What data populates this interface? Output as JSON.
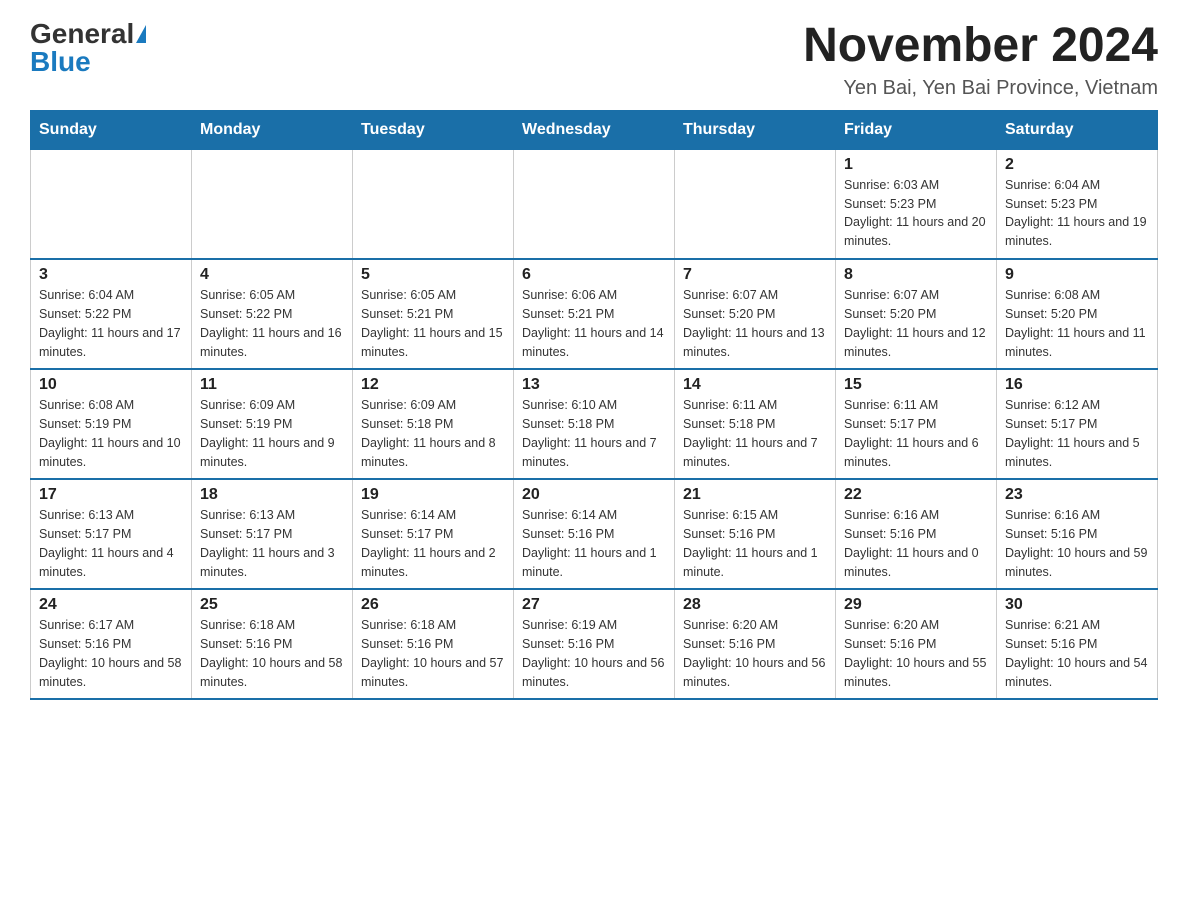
{
  "logo": {
    "general": "General",
    "blue": "Blue"
  },
  "title": "November 2024",
  "subtitle": "Yen Bai, Yen Bai Province, Vietnam",
  "weekdays": [
    "Sunday",
    "Monday",
    "Tuesday",
    "Wednesday",
    "Thursday",
    "Friday",
    "Saturday"
  ],
  "weeks": [
    [
      {
        "day": "",
        "info": ""
      },
      {
        "day": "",
        "info": ""
      },
      {
        "day": "",
        "info": ""
      },
      {
        "day": "",
        "info": ""
      },
      {
        "day": "",
        "info": ""
      },
      {
        "day": "1",
        "info": "Sunrise: 6:03 AM\nSunset: 5:23 PM\nDaylight: 11 hours and 20 minutes."
      },
      {
        "day": "2",
        "info": "Sunrise: 6:04 AM\nSunset: 5:23 PM\nDaylight: 11 hours and 19 minutes."
      }
    ],
    [
      {
        "day": "3",
        "info": "Sunrise: 6:04 AM\nSunset: 5:22 PM\nDaylight: 11 hours and 17 minutes."
      },
      {
        "day": "4",
        "info": "Sunrise: 6:05 AM\nSunset: 5:22 PM\nDaylight: 11 hours and 16 minutes."
      },
      {
        "day": "5",
        "info": "Sunrise: 6:05 AM\nSunset: 5:21 PM\nDaylight: 11 hours and 15 minutes."
      },
      {
        "day": "6",
        "info": "Sunrise: 6:06 AM\nSunset: 5:21 PM\nDaylight: 11 hours and 14 minutes."
      },
      {
        "day": "7",
        "info": "Sunrise: 6:07 AM\nSunset: 5:20 PM\nDaylight: 11 hours and 13 minutes."
      },
      {
        "day": "8",
        "info": "Sunrise: 6:07 AM\nSunset: 5:20 PM\nDaylight: 11 hours and 12 minutes."
      },
      {
        "day": "9",
        "info": "Sunrise: 6:08 AM\nSunset: 5:20 PM\nDaylight: 11 hours and 11 minutes."
      }
    ],
    [
      {
        "day": "10",
        "info": "Sunrise: 6:08 AM\nSunset: 5:19 PM\nDaylight: 11 hours and 10 minutes."
      },
      {
        "day": "11",
        "info": "Sunrise: 6:09 AM\nSunset: 5:19 PM\nDaylight: 11 hours and 9 minutes."
      },
      {
        "day": "12",
        "info": "Sunrise: 6:09 AM\nSunset: 5:18 PM\nDaylight: 11 hours and 8 minutes."
      },
      {
        "day": "13",
        "info": "Sunrise: 6:10 AM\nSunset: 5:18 PM\nDaylight: 11 hours and 7 minutes."
      },
      {
        "day": "14",
        "info": "Sunrise: 6:11 AM\nSunset: 5:18 PM\nDaylight: 11 hours and 7 minutes."
      },
      {
        "day": "15",
        "info": "Sunrise: 6:11 AM\nSunset: 5:17 PM\nDaylight: 11 hours and 6 minutes."
      },
      {
        "day": "16",
        "info": "Sunrise: 6:12 AM\nSunset: 5:17 PM\nDaylight: 11 hours and 5 minutes."
      }
    ],
    [
      {
        "day": "17",
        "info": "Sunrise: 6:13 AM\nSunset: 5:17 PM\nDaylight: 11 hours and 4 minutes."
      },
      {
        "day": "18",
        "info": "Sunrise: 6:13 AM\nSunset: 5:17 PM\nDaylight: 11 hours and 3 minutes."
      },
      {
        "day": "19",
        "info": "Sunrise: 6:14 AM\nSunset: 5:17 PM\nDaylight: 11 hours and 2 minutes."
      },
      {
        "day": "20",
        "info": "Sunrise: 6:14 AM\nSunset: 5:16 PM\nDaylight: 11 hours and 1 minute."
      },
      {
        "day": "21",
        "info": "Sunrise: 6:15 AM\nSunset: 5:16 PM\nDaylight: 11 hours and 1 minute."
      },
      {
        "day": "22",
        "info": "Sunrise: 6:16 AM\nSunset: 5:16 PM\nDaylight: 11 hours and 0 minutes."
      },
      {
        "day": "23",
        "info": "Sunrise: 6:16 AM\nSunset: 5:16 PM\nDaylight: 10 hours and 59 minutes."
      }
    ],
    [
      {
        "day": "24",
        "info": "Sunrise: 6:17 AM\nSunset: 5:16 PM\nDaylight: 10 hours and 58 minutes."
      },
      {
        "day": "25",
        "info": "Sunrise: 6:18 AM\nSunset: 5:16 PM\nDaylight: 10 hours and 58 minutes."
      },
      {
        "day": "26",
        "info": "Sunrise: 6:18 AM\nSunset: 5:16 PM\nDaylight: 10 hours and 57 minutes."
      },
      {
        "day": "27",
        "info": "Sunrise: 6:19 AM\nSunset: 5:16 PM\nDaylight: 10 hours and 56 minutes."
      },
      {
        "day": "28",
        "info": "Sunrise: 6:20 AM\nSunset: 5:16 PM\nDaylight: 10 hours and 56 minutes."
      },
      {
        "day": "29",
        "info": "Sunrise: 6:20 AM\nSunset: 5:16 PM\nDaylight: 10 hours and 55 minutes."
      },
      {
        "day": "30",
        "info": "Sunrise: 6:21 AM\nSunset: 5:16 PM\nDaylight: 10 hours and 54 minutes."
      }
    ]
  ]
}
